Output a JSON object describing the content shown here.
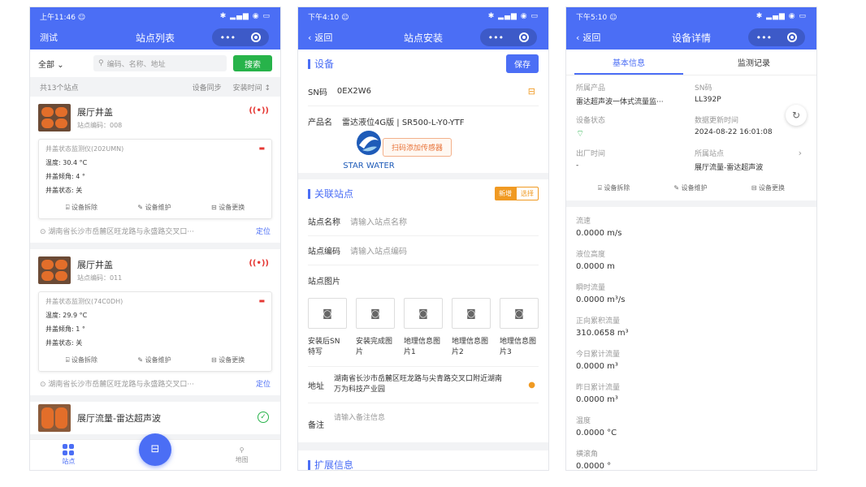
{
  "phone1": {
    "status": {
      "time": "上午11:46 ☺",
      "icons": "✱ ▂▄▆ ◉ ▭"
    },
    "nav": {
      "left": "测试",
      "title": "站点列表",
      "dots": "•••"
    },
    "filter": {
      "all": "全部",
      "search_placeholder": "编码、名称、地址",
      "search_btn": "搜索"
    },
    "countbar": {
      "count": "共13个站点",
      "sync": "设备同步",
      "sort": "安装时间 ↕"
    },
    "cards": [
      {
        "name": "展厅井盖",
        "code": "站点编码：008",
        "sig": "((•))",
        "device": "井盖状态监测仪(202UMN)",
        "temp": "温度: 30.4 °C",
        "tilt": "井盖倾角: 4 °",
        "state": "井盖状态: 关",
        "a1": "设备拆除",
        "a2": "设备维护",
        "a3": "设备更换",
        "addr": "湖南省长沙市岳麓区旺龙路与永盛路交叉口···",
        "loc": "定位"
      },
      {
        "name": "展厅井盖",
        "code": "站点编码：011",
        "sig": "((•))",
        "device": "井盖状态监测仪(74C0DH)",
        "temp": "温度: 29.9 °C",
        "tilt": "井盖倾角: 1 °",
        "state": "井盖状态: 关",
        "a1": "设备拆除",
        "a2": "设备维护",
        "a3": "设备更换",
        "addr": "湖南省长沙市岳麓区旺龙路与永盛路交叉口···",
        "loc": "定位"
      }
    ],
    "card3": {
      "name": "展厅流量-雷达超声波",
      "ok": "✓"
    },
    "tabbar": {
      "site": "站点",
      "map": "地图",
      "scan": "⊟"
    }
  },
  "phone2": {
    "status": {
      "time": "下午4:10 ☺",
      "icons": "✱ ▂▄▆ ◉ ▭"
    },
    "nav": {
      "back": "返回",
      "title": "站点安装",
      "dots": "•••"
    },
    "device": {
      "title": "设备",
      "save": "保存",
      "sn_k": "SN码",
      "sn_v": "0EX2W6",
      "prod_k": "产品名",
      "prod_v": "雷达液位4G版 | SR500-L-Y0-YTF",
      "scan": "扫码添加传感器"
    },
    "logo": "STAR WATER",
    "station": {
      "title": "关联站点",
      "new": "新增",
      "select": "选择",
      "name_k": "站点名称",
      "name_ph": "请输入站点名称",
      "code_k": "站点编码",
      "code_ph": "请输入站点编码",
      "pic_k": "站点图片",
      "labels": [
        "安装后SN特写",
        "安装完成图片",
        "地理信息图片1",
        "地理信息图片2",
        "地理信息图片3"
      ],
      "addr_k": "地址",
      "addr_v": "湖南省长沙市岳麓区旺龙路与尖青路交叉口附近湖南万为科技产业园",
      "note_k": "备注",
      "note_ph": "请输入备注信息"
    },
    "ext": {
      "title": "扩展信息"
    }
  },
  "phone3": {
    "status": {
      "time": "下午5:10 ☺",
      "icons": "✱ ▂▄▆ ◉ ▭"
    },
    "nav": {
      "back": "返回",
      "title": "设备详情",
      "dots": "•••"
    },
    "tabs": {
      "basic": "基本信息",
      "monitor": "监测记录"
    },
    "info": {
      "prod_k": "所属产品",
      "prod_v": "雷达超声波一体式流量监···",
      "sn_k": "SN码",
      "sn_v": "LL392P",
      "st_k": "设备状态",
      "upd_k": "数据更新时间",
      "upd_v": "2024-08-22 16:01:08",
      "out_k": "出厂时间",
      "out_v": "-",
      "site_k": "所属站点",
      "site_v": "展厅流量-雷达超声波",
      "a1": "设备拆除",
      "a2": "设备维护",
      "a3": "设备更换"
    },
    "data": [
      {
        "k": "流速",
        "v": "0.0000 m/s"
      },
      {
        "k": "液位高度",
        "v": "0.0000 m"
      },
      {
        "k": "瞬时流量",
        "v": "0.0000 m³/s"
      },
      {
        "k": "正向累积流量",
        "v": "310.0658 m³"
      },
      {
        "k": "今日累计流量",
        "v": "0.0000 m³"
      },
      {
        "k": "昨日累计流量",
        "v": "0.0000 m³"
      },
      {
        "k": "温度",
        "v": "0.0000 °C"
      },
      {
        "k": "横滚角",
        "v": "0.0000 °"
      }
    ]
  },
  "colors": {
    "primary": "#4b6ef5",
    "green": "#27b34a",
    "orange": "#f09a23",
    "red": "#e53935"
  }
}
